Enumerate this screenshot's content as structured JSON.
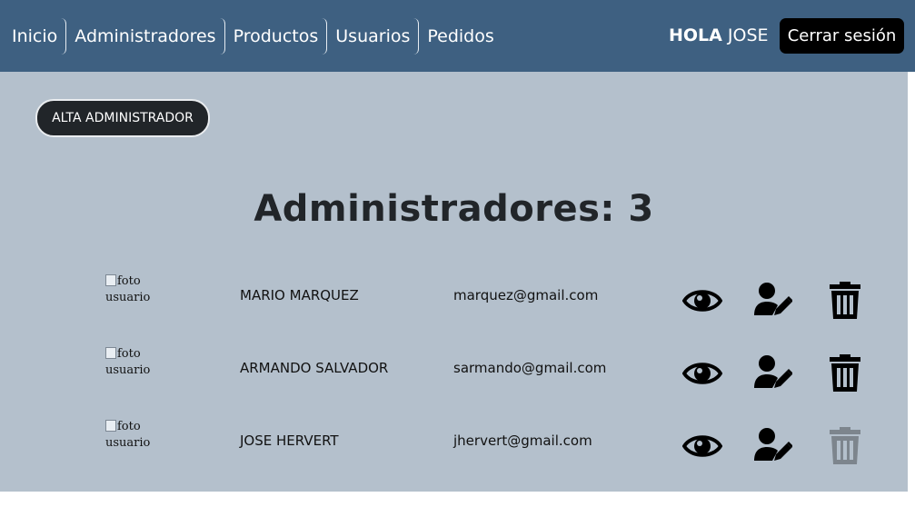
{
  "nav": {
    "links": [
      {
        "label": "Inicio"
      },
      {
        "label": "Administradores"
      },
      {
        "label": "Productos"
      },
      {
        "label": "Usuarios"
      },
      {
        "label": "Pedidos"
      }
    ],
    "greeting_bold": "HOLA",
    "greeting_name": "JOSE",
    "logout_label": "Cerrar sesión"
  },
  "main": {
    "add_button_label": "ALTA ADMINISTRADOR",
    "title": "Administradores: 3",
    "photo_alt": "foto usuario",
    "rows": [
      {
        "name": "MARIO MARQUEZ",
        "email": "marquez@gmail.com",
        "delete_enabled": true
      },
      {
        "name": "ARMANDO SALVADOR",
        "email": "sarmando@gmail.com",
        "delete_enabled": true
      },
      {
        "name": "JOSE HERVERT",
        "email": "jhervert@gmail.com",
        "delete_enabled": false
      }
    ]
  },
  "icons": [
    "eye-icon",
    "user-edit-icon",
    "trash-icon"
  ],
  "colors": {
    "navbar": "#3e6081",
    "content_background": "#b4c0cc",
    "button_dark": "#212529",
    "logout_button": "#000000"
  }
}
